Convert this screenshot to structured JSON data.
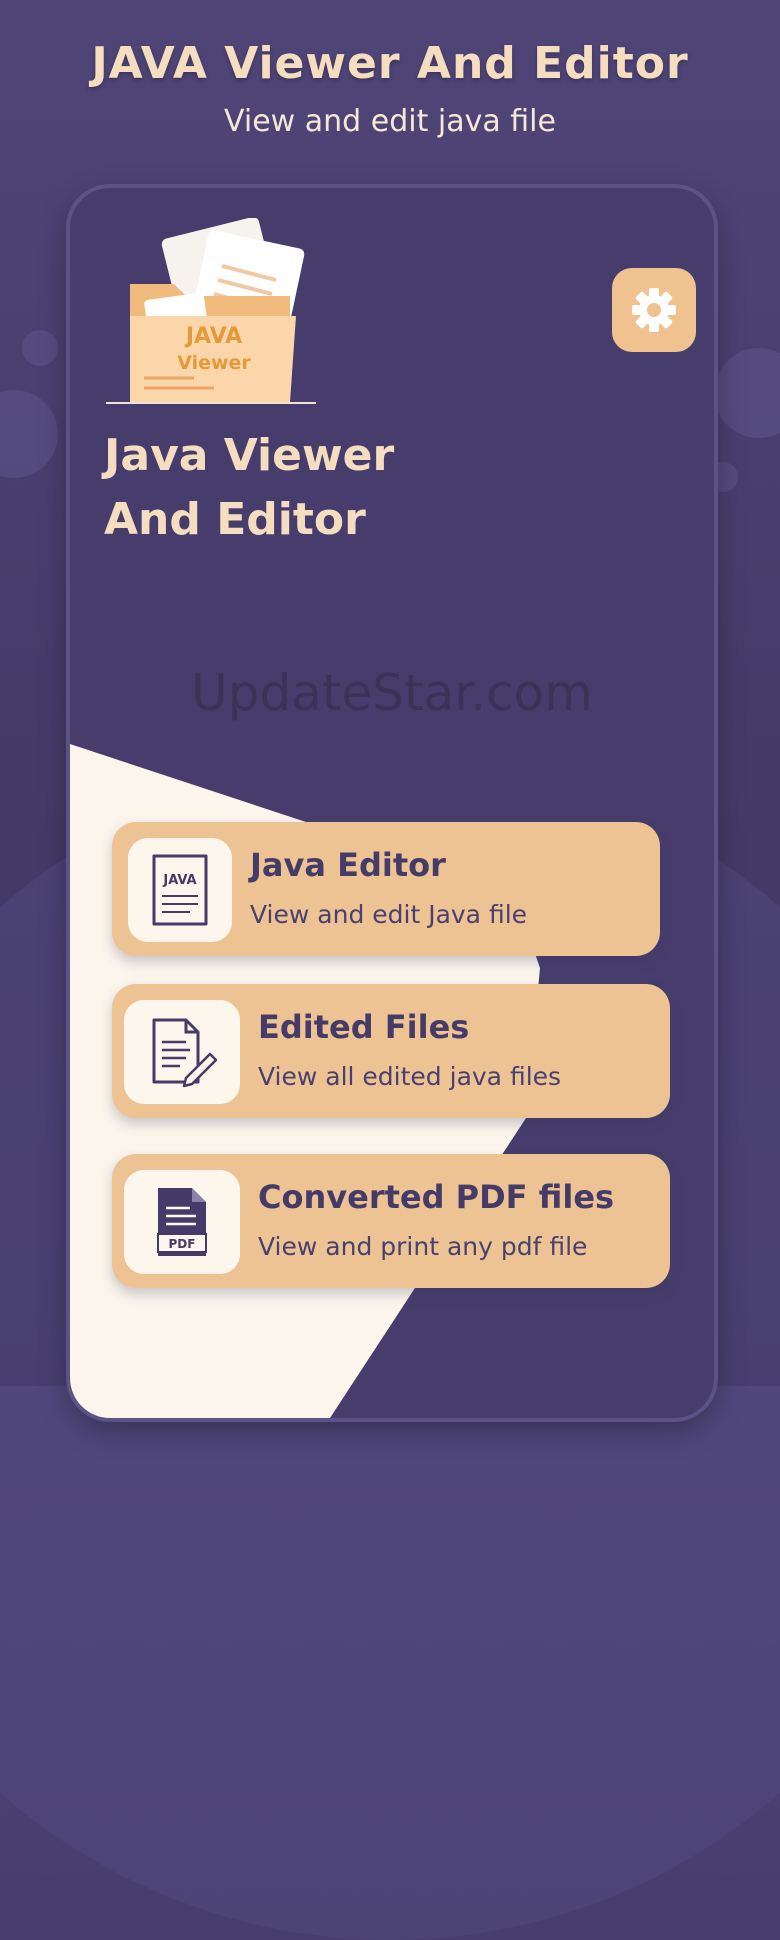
{
  "promo": {
    "title": "JAVA Viewer And Editor",
    "subtitle": "View and edit java file"
  },
  "app": {
    "title_line1": "Java Viewer",
    "title_line2": "And Editor",
    "logo": {
      "line1": "JAVA",
      "line2": "Viewer"
    },
    "settings_icon": "gear-icon"
  },
  "watermark": "UpdateStar.com",
  "menu": [
    {
      "title": "Java Editor",
      "subtitle": "View and edit Java file",
      "icon": "java-file-icon",
      "icon_text": "JAVA"
    },
    {
      "title": "Edited Files",
      "subtitle": "View all edited java files",
      "icon": "edited-document-icon"
    },
    {
      "title": "Converted PDF files",
      "subtitle": "View and print any pdf file",
      "icon": "pdf-file-icon",
      "icon_text": "PDF"
    }
  ],
  "colors": {
    "background": "#4f4577",
    "accent": "#eec393",
    "title": "#f5ddc0",
    "cream": "#fbf5ec",
    "text_dark": "#453b69"
  }
}
